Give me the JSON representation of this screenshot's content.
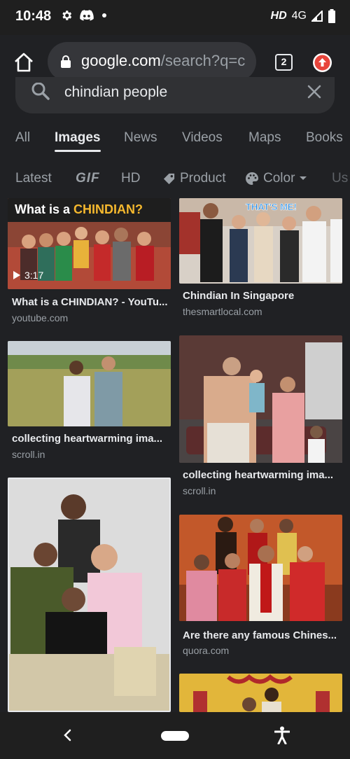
{
  "status_bar": {
    "time": "10:48",
    "hd": "HD",
    "network": "4G"
  },
  "toolbar": {
    "url_host": "google.com",
    "url_path": "/search?q=c",
    "tab_count": "2"
  },
  "search": {
    "query": "chindian people"
  },
  "tabs": [
    "All",
    "Images",
    "News",
    "Videos",
    "Maps",
    "Books"
  ],
  "active_tab": "Images",
  "filters": {
    "latest": "Latest",
    "gif": "GIF",
    "hd": "HD",
    "product": "Product",
    "color": "Color",
    "usage": "Us"
  },
  "results": [
    {
      "title": "What is a CHINDIAN? - YouTu...",
      "source": "youtube.com",
      "overlay": "What is a CHINDIAN?",
      "duration": "3:17"
    },
    {
      "title": "Chindian In Singapore",
      "source": "thesmartlocal.com",
      "overlay": "THAT'S ME!"
    },
    {
      "title": "collecting heartwarming ima...",
      "source": "scroll.in"
    },
    {
      "title": "collecting heartwarming ima...",
      "source": "scroll.in"
    },
    {
      "title": "Are there any famous Chines...",
      "source": "quora.com"
    }
  ]
}
